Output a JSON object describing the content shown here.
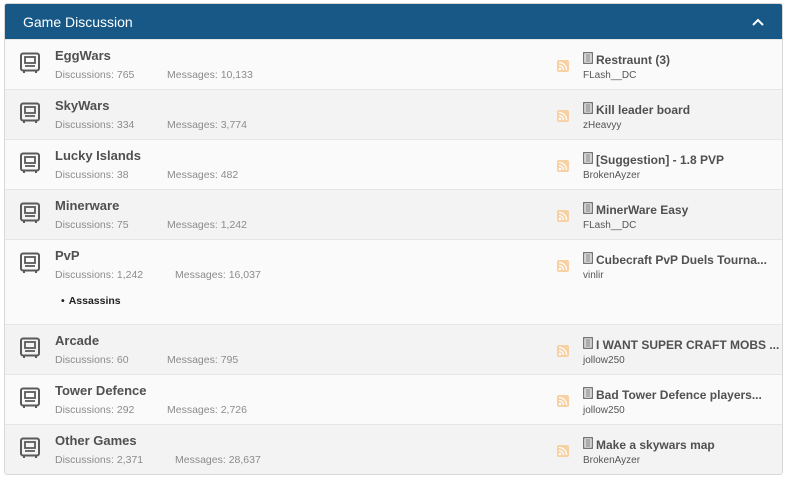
{
  "header": {
    "title": "Game Discussion"
  },
  "labels": {
    "discussions": "Discussions:",
    "messages": "Messages:"
  },
  "nodes": [
    {
      "title": "EggWars",
      "discussions": "765",
      "messages": "10,133",
      "last_title": "Restraunt (3)",
      "last_user": "FLash__DC",
      "subforums": []
    },
    {
      "title": "SkyWars",
      "discussions": "334",
      "messages": "3,774",
      "last_title": "Kill leader board",
      "last_user": "zHeavyy",
      "subforums": []
    },
    {
      "title": "Lucky Islands",
      "discussions": "38",
      "messages": "482",
      "last_title": "[Suggestion] - 1.8 PVP",
      "last_user": "BrokenAyzer",
      "subforums": []
    },
    {
      "title": "Minerware",
      "discussions": "75",
      "messages": "1,242",
      "last_title": "MinerWare Easy",
      "last_user": "FLash__DC",
      "subforums": []
    },
    {
      "title": "PvP",
      "discussions": "1,242",
      "messages": "16,037",
      "last_title": "Cubecraft PvP Duels Tourna...",
      "last_user": "vinlir",
      "subforums": [
        "Assassins"
      ]
    },
    {
      "title": "Arcade",
      "discussions": "60",
      "messages": "795",
      "last_title": "I WANT SUPER CRAFT MOBS ...",
      "last_user": "jollow250",
      "subforums": []
    },
    {
      "title": "Tower Defence",
      "discussions": "292",
      "messages": "2,726",
      "last_title": "Bad Tower Defence players...",
      "last_user": "jollow250",
      "subforums": []
    },
    {
      "title": "Other Games",
      "discussions": "2,371",
      "messages": "28,637",
      "last_title": "Make a skywars map",
      "last_user": "BrokenAyzer",
      "subforums": []
    }
  ],
  "icons": {
    "node": "forum-node-icon",
    "rss": "rss-icon",
    "last_post": "document-icon",
    "collapse": "chevron-up-icon"
  },
  "colors": {
    "header_bg": "#185886",
    "rss": "#f7d0a4",
    "title": "#505050"
  }
}
